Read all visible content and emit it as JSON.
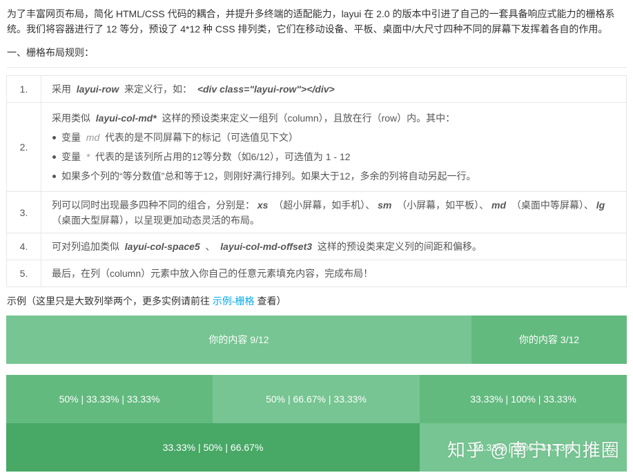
{
  "intro": {
    "line1": "为了丰富网页布局，简化 HTML/CSS 代码的耦合，并提升多终端的适配能力，layui 在 2.0 的版本中引进了自己的一套具备响应式能力的栅格系",
    "line2": "统。我们将容器进行了 12 等分，预设了 4*12 种 CSS 排列类，它们在移动设备、平板、桌面中/大尺寸四种不同的屏幕下发挥着各自的作用。"
  },
  "section_title": "一、栅格布局规则：",
  "rules": [
    {
      "num": "1.",
      "pre": "采用",
      "code1": "layui-row",
      "mid": "来定义行，如：",
      "code2": "<div class=\"layui-row\"></div>"
    },
    {
      "num": "2.",
      "pre": "采用类似",
      "code1": "layui-col-md*",
      "post": "这样的预设类来定义一组列（column），且放在行（row）内。其中：",
      "bullets": [
        {
          "pre": "变量",
          "code": "md",
          "post": "代表的是不同屏幕下的标记（可选值见下文）"
        },
        {
          "pre": "变量",
          "code": "*",
          "post": "代表的是该列所占用的12等分数（如6/12），可选值为 1 - 12"
        },
        {
          "pre": "",
          "code": "",
          "post": "如果多个列的“等分数值”总和等于12，则刚好满行排列。如果大于12，多余的列将自动另起一行。"
        }
      ]
    },
    {
      "num": "3.",
      "pre": "列可以同时出现最多四种不同的组合，分别是：",
      "xs": "xs",
      "xs_desc": "（超小屏幕，如手机）、",
      "sm": "sm",
      "sm_desc": "（小屏幕，如平板）、",
      "md": "md",
      "md_desc": "（桌面中等屏幕）、",
      "lg": "lg",
      "line2": "（桌面大型屏幕），以呈现更加动态灵活的布局。"
    },
    {
      "num": "4.",
      "pre": "可对列追加类似",
      "code1": "layui-col-space5",
      "mid": "、",
      "code2": "layui-col-md-offset3",
      "post": "这样的预设类来定义列的间距和偏移。"
    },
    {
      "num": "5.",
      "text": "最后，在列（column）元素中放入你自己的任意元素填充内容，完成布局！"
    }
  ],
  "example": {
    "pre": "示例（这里只是大致列举两个，更多实例请前往",
    "link": "示例-栅格",
    "post": "查看）"
  },
  "grid": {
    "row1": [
      {
        "label": "你的内容 9/12",
        "color": "#76C592"
      },
      {
        "label": "你的内容 3/12",
        "color": "#63BA7F"
      }
    ],
    "row2": [
      {
        "label": "50% | 33.33% | 33.33%",
        "color": "#63BA7F"
      },
      {
        "label": "50% | 66.67% | 33.33%",
        "color": "#76C592"
      },
      {
        "label": "33.33% | 100% | 33.33%",
        "color": "#63BA7F"
      }
    ],
    "row3": [
      {
        "label": "33.33% | 50% | 66.67%",
        "color": "#48A866"
      },
      {
        "label": "33.33% | 50% | 33.33%",
        "color": "#76C592"
      }
    ]
  },
  "watermark": "知乎 @南宁IT内推圈"
}
